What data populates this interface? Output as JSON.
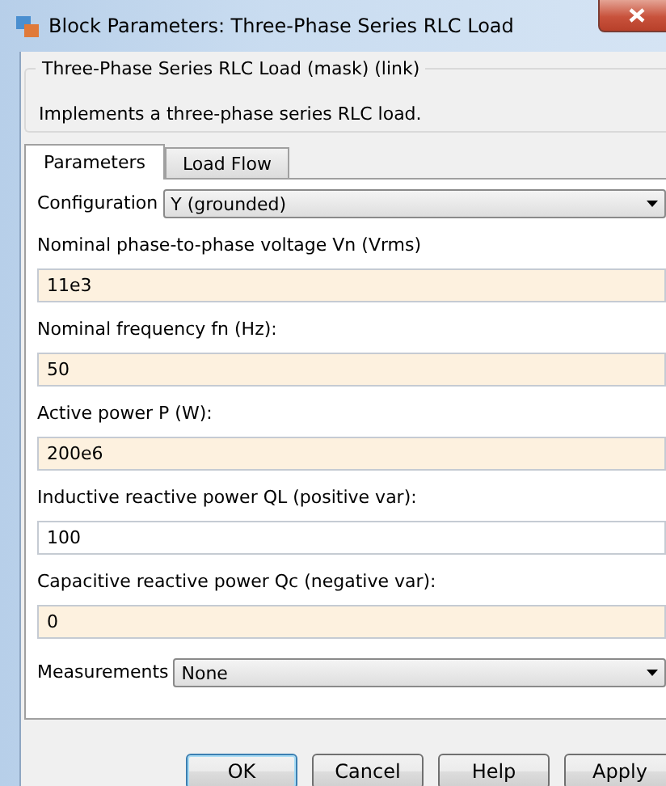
{
  "window": {
    "title": "Block Parameters: Three-Phase Series RLC Load"
  },
  "group": {
    "title": "Three-Phase Series RLC Load (mask) (link)",
    "description": "Implements a three-phase series RLC load."
  },
  "tabs": [
    {
      "label": "Parameters",
      "selected": true
    },
    {
      "label": "Load Flow",
      "selected": false
    }
  ],
  "parameters": [
    {
      "kind": "dropdown",
      "label": "Configuration",
      "value": "Y (grounded)"
    },
    {
      "kind": "field",
      "label": "Nominal phase-to-phase voltage Vn (Vrms)",
      "value": "11e3",
      "highlighted": true
    },
    {
      "kind": "field",
      "label": "Nominal frequency fn (Hz):",
      "value": "50",
      "highlighted": true
    },
    {
      "kind": "field",
      "label": "Active power P (W):",
      "value": "200e6",
      "highlighted": true
    },
    {
      "kind": "field",
      "label": "Inductive reactive power QL (positive var):",
      "value": "100",
      "highlighted": false
    },
    {
      "kind": "field",
      "label": "Capacitive reactive power Qc (negative var):",
      "value": "0",
      "highlighted": true
    },
    {
      "kind": "dropdown",
      "label": "Measurements",
      "value": "None"
    }
  ],
  "buttons": [
    {
      "label": "OK",
      "default": true
    },
    {
      "label": "Cancel",
      "default": false
    },
    {
      "label": "Help",
      "default": false
    },
    {
      "label": "Apply",
      "default": false
    }
  ]
}
